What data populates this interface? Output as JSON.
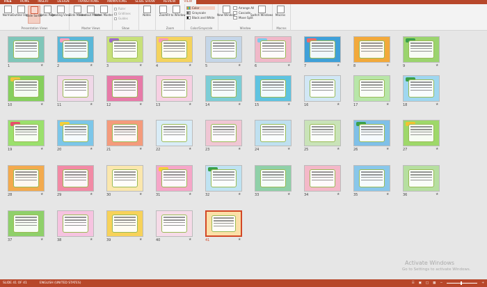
{
  "ribbon": {
    "tabs": [
      "FILE",
      "HOME",
      "INSERT",
      "DESIGN",
      "TRANSITIONS",
      "ANIMATIONS",
      "SLIDE SHOW",
      "REVIEW",
      "VIEW"
    ],
    "active_tab": "VIEW",
    "groups": {
      "presentation_views": {
        "caption": "Presentation Views",
        "buttons": [
          "Normal",
          "Outline View",
          "Slide Sorter",
          "Notes Page",
          "Reading View"
        ]
      },
      "master_views": {
        "caption": "Master Views",
        "buttons": [
          "Slide Master",
          "Handout Master",
          "Notes Master"
        ]
      },
      "show": {
        "caption": "Show",
        "checkboxes": [
          "Ruler",
          "Gridlines",
          "Guides"
        ]
      },
      "notes": {
        "buttons": [
          "Notes"
        ]
      },
      "zoom": {
        "caption": "Zoom",
        "buttons": [
          "Zoom",
          "Fit to Window"
        ]
      },
      "color_grayscale": {
        "caption": "Color/Grayscale",
        "options": [
          "Color",
          "Grayscale",
          "Black and White"
        ],
        "selected": "Color"
      },
      "window": {
        "caption": "Window",
        "new_window": "New Window",
        "arrange": [
          "Arrange All",
          "Cascade",
          "Move Split"
        ],
        "switch": "Switch Windows"
      },
      "macros": {
        "caption": "Macros",
        "button": "Macros"
      }
    }
  },
  "slides": [
    {
      "n": "1",
      "bg": "#7fc6b9",
      "tag": ""
    },
    {
      "n": "2",
      "bg": "#5ab7d8",
      "tag": "#f7a1c0"
    },
    {
      "n": "3",
      "bg": "#c7e07a",
      "tag": "#9c6bc8"
    },
    {
      "n": "4",
      "bg": "#f4d35e",
      "tag": "#f59bb8"
    },
    {
      "n": "5",
      "bg": "#c5d6e8",
      "tag": ""
    },
    {
      "n": "6",
      "bg": "#f0b8c8",
      "tag": "#7ec9e8"
    },
    {
      "n": "7",
      "bg": "#3fa0d8",
      "tag": "#f06a6a"
    },
    {
      "n": "8",
      "bg": "#f2a93b",
      "tag": ""
    },
    {
      "n": "9",
      "bg": "#9bd46e",
      "tag": "#3aa04a"
    },
    {
      "n": "10",
      "bg": "#86cf5d",
      "tag": "#f3c43d"
    },
    {
      "n": "11",
      "bg": "#f0d8e8",
      "tag": ""
    },
    {
      "n": "12",
      "bg": "#e77aa8",
      "tag": ""
    },
    {
      "n": "13",
      "bg": "#f7d0e3",
      "tag": ""
    },
    {
      "n": "14",
      "bg": "#7dcdd6",
      "tag": ""
    },
    {
      "n": "15",
      "bg": "#5fc3e0",
      "tag": ""
    },
    {
      "n": "16",
      "bg": "#d1e7f5",
      "tag": ""
    },
    {
      "n": "17",
      "bg": "#b8e6a8",
      "tag": ""
    },
    {
      "n": "18",
      "bg": "#9fd7f0",
      "tag": "#3aa04a"
    },
    {
      "n": "19",
      "bg": "#9be06d",
      "tag": "#e84d6a"
    },
    {
      "n": "20",
      "bg": "#7cc6e9",
      "tag": "#f5cf3a"
    },
    {
      "n": "21",
      "bg": "#f49b7c",
      "tag": ""
    },
    {
      "n": "22",
      "bg": "#d9ecf7",
      "tag": ""
    },
    {
      "n": "23",
      "bg": "#f0c6d4",
      "tag": ""
    },
    {
      "n": "24",
      "bg": "#bfe0f0",
      "tag": ""
    },
    {
      "n": "25",
      "bg": "#c9e3b8",
      "tag": ""
    },
    {
      "n": "26",
      "bg": "#7fc0e8",
      "tag": "#3aa04a"
    },
    {
      "n": "27",
      "bg": "#9ed86a",
      "tag": "#f2c232"
    },
    {
      "n": "28",
      "bg": "#f3aa4e",
      "tag": ""
    },
    {
      "n": "29",
      "bg": "#f28aa5",
      "tag": ""
    },
    {
      "n": "30",
      "bg": "#fbe7ad",
      "tag": ""
    },
    {
      "n": "31",
      "bg": "#f6a6c8",
      "tag": "#f5cf3a"
    },
    {
      "n": "32",
      "bg": "#bfe3f2",
      "tag": "#3aa04a"
    },
    {
      "n": "33",
      "bg": "#8fd0a8",
      "tag": ""
    },
    {
      "n": "34",
      "bg": "#f4b8c8",
      "tag": ""
    },
    {
      "n": "35",
      "bg": "#89c7ea",
      "tag": ""
    },
    {
      "n": "36",
      "bg": "#b6dfa0",
      "tag": ""
    },
    {
      "n": "37",
      "bg": "#8fd06a",
      "tag": ""
    },
    {
      "n": "38",
      "bg": "#f6c3e0",
      "tag": ""
    },
    {
      "n": "39",
      "bg": "#f7d25a",
      "tag": ""
    },
    {
      "n": "40",
      "bg": "#f6dbe8",
      "tag": ""
    },
    {
      "n": "41",
      "bg": "#fbe0a8",
      "tag": ""
    }
  ],
  "selected_slide": "41",
  "watermark": {
    "line1": "Activate Windows",
    "line2": "Go to Settings to activate Windows."
  },
  "status": {
    "slide_counter": "SLIDE 41 OF 41",
    "language": "ENGLISH (UNITED STATES)"
  },
  "colors": {
    "accent": "#b7472a",
    "selection": "#d24726",
    "canvas": "#e6e6e6"
  }
}
